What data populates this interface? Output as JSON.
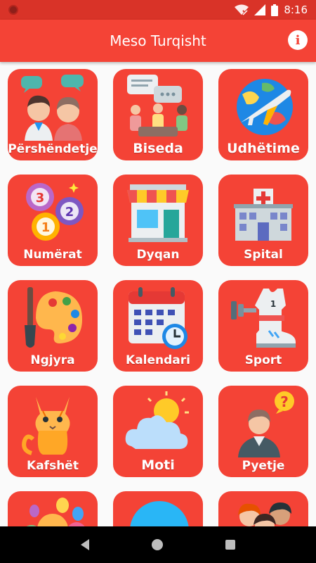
{
  "status_bar": {
    "time": "8:16",
    "icons": [
      "record-icon",
      "wifi-off-icon",
      "signal-icon",
      "battery-icon"
    ]
  },
  "app_bar": {
    "title": "Meso Turqisht",
    "info_icon": "info-icon"
  },
  "colors": {
    "primary": "#f44336",
    "status_bar": "#d93328",
    "background": "#fafafa",
    "nav_bar": "#000000"
  },
  "tiles": [
    {
      "label": "Përshëndetje",
      "icon": "greeting-people-icon"
    },
    {
      "label": "Biseda",
      "icon": "conversation-icon"
    },
    {
      "label": "Udhëtime",
      "icon": "travel-plane-icon"
    },
    {
      "label": "Numërat",
      "icon": "numbers-balloons-icon"
    },
    {
      "label": "Dyqan",
      "icon": "shop-icon"
    },
    {
      "label": "Spital",
      "icon": "hospital-icon"
    },
    {
      "label": "Ngjyra",
      "icon": "paint-palette-icon"
    },
    {
      "label": "Kalendari",
      "icon": "calendar-icon"
    },
    {
      "label": "Sport",
      "icon": "sport-icon"
    },
    {
      "label": "Kafshët",
      "icon": "cat-icon"
    },
    {
      "label": "Moti",
      "icon": "weather-icon"
    },
    {
      "label": "Pyetje",
      "icon": "question-person-icon"
    },
    {
      "label": "",
      "icon": "party-balloons-icon"
    },
    {
      "label": "",
      "icon": "chat-bubble-icon"
    },
    {
      "label": "",
      "icon": "family-icon"
    }
  ],
  "nav_bar": {
    "back_icon": "back-icon",
    "home_icon": "home-icon",
    "recents_icon": "recents-icon"
  }
}
